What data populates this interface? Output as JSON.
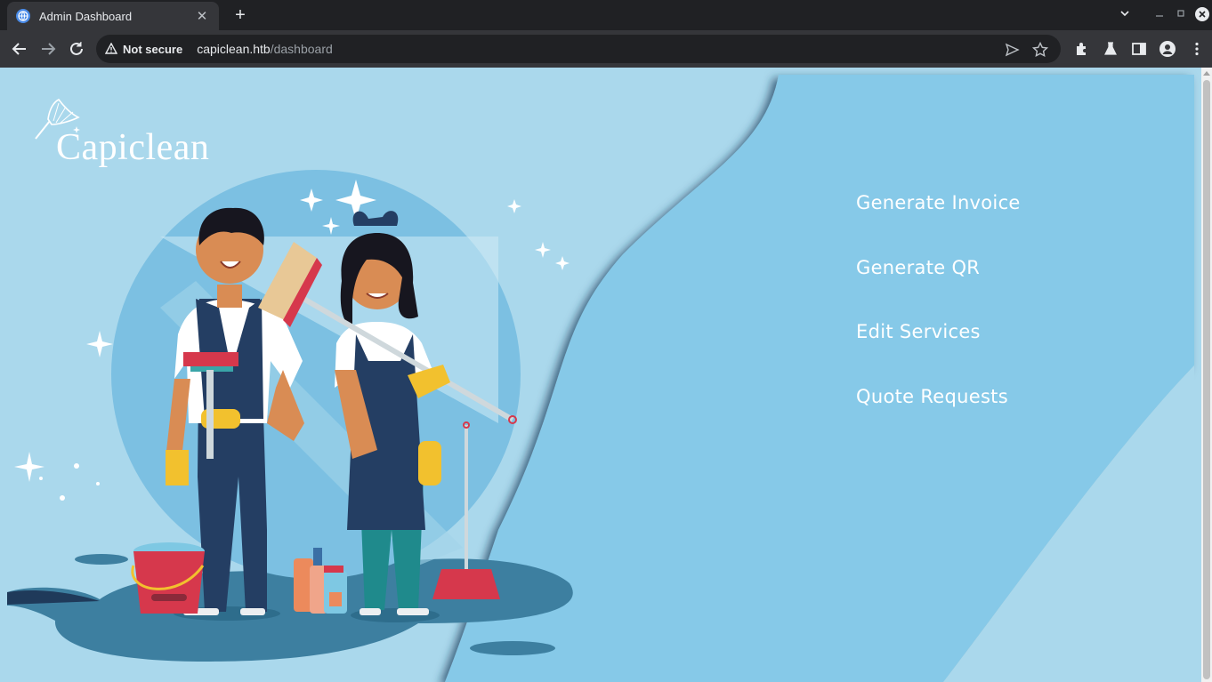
{
  "browser": {
    "tab_title": "Admin Dashboard",
    "security_label": "Not secure",
    "url_host": "capiclean.htb",
    "url_path": "/dashboard"
  },
  "page": {
    "brand": "Capiclean",
    "menu": [
      {
        "label": "Generate Invoice"
      },
      {
        "label": "Generate QR"
      },
      {
        "label": "Edit Services"
      },
      {
        "label": "Quote Requests"
      }
    ]
  },
  "colors": {
    "background_light": "#aad8ec",
    "panel": "#86c9e8",
    "wave_shadow": "#1f3a5a",
    "illustration_primary": "#243e63",
    "accent_yellow": "#f2c12e",
    "accent_red": "#d6384c"
  }
}
